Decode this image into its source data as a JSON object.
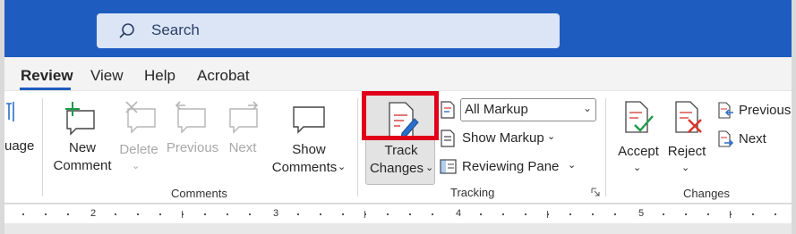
{
  "search": {
    "placeholder": "Search"
  },
  "tabs": [
    {
      "label": "Review",
      "active": true
    },
    {
      "label": "View"
    },
    {
      "label": "Help"
    },
    {
      "label": "Acrobat"
    }
  ],
  "ribbon": {
    "language_partial": "uage",
    "comments": {
      "new_comment": [
        "New",
        "Comment"
      ],
      "delete": "Delete",
      "previous": "Previous",
      "next": "Next",
      "show_comments": [
        "Show",
        "Comments"
      ],
      "group_label": "Comments"
    },
    "tracking": {
      "track_changes": [
        "Track",
        "Changes"
      ],
      "markup_select": "All Markup",
      "show_markup": "Show Markup",
      "reviewing_pane": "Reviewing Pane",
      "group_label": "Tracking"
    },
    "changes": {
      "accept": "Accept",
      "reject": "Reject",
      "previous": "Previous",
      "next": "Next",
      "group_label": "Changes"
    }
  },
  "ruler": {
    "numbers": [
      "2",
      "3",
      "4",
      "5"
    ]
  },
  "colors": {
    "accent": "#1f5cc0",
    "highlight": "#e0001a"
  }
}
